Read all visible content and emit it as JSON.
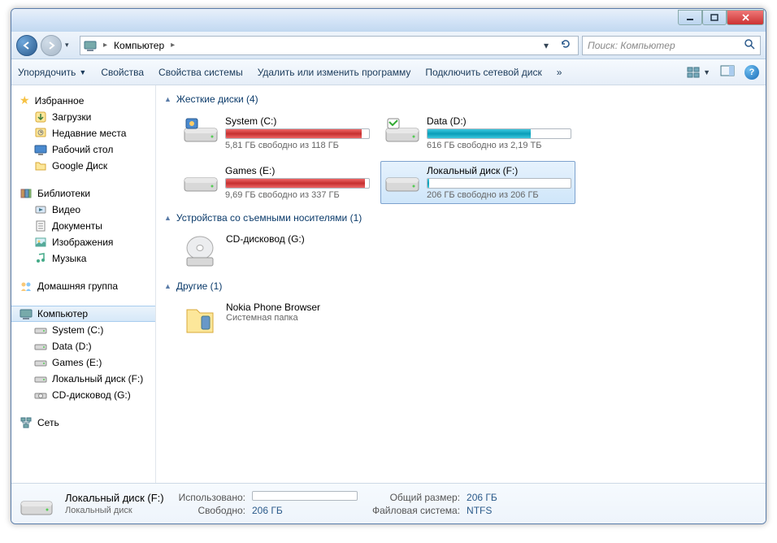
{
  "titlebar": {},
  "nav": {
    "breadcrumb_root": "Компьютер",
    "search_placeholder": "Поиск: Компьютер"
  },
  "toolbar": {
    "organize": "Упорядочить",
    "properties": "Свойства",
    "system_properties": "Свойства системы",
    "uninstall": "Удалить или изменить программу",
    "network_drive": "Подключить сетевой диск",
    "more": "»"
  },
  "sidebar": {
    "favorites": {
      "label": "Избранное",
      "items": [
        {
          "label": "Загрузки"
        },
        {
          "label": "Недавние места"
        },
        {
          "label": "Рабочий стол"
        },
        {
          "label": "Google Диск"
        }
      ]
    },
    "libraries": {
      "label": "Библиотеки",
      "items": [
        {
          "label": "Видео"
        },
        {
          "label": "Документы"
        },
        {
          "label": "Изображения"
        },
        {
          "label": "Музыка"
        }
      ]
    },
    "homegroup": {
      "label": "Домашняя группа"
    },
    "computer": {
      "label": "Компьютер",
      "items": [
        {
          "label": "System (C:)"
        },
        {
          "label": "Data (D:)"
        },
        {
          "label": "Games (E:)"
        },
        {
          "label": "Локальный диск (F:)"
        },
        {
          "label": "CD-дисковод (G:)"
        }
      ]
    },
    "network": {
      "label": "Сеть"
    }
  },
  "sections": {
    "hdd": {
      "title": "Жесткие диски (4)"
    },
    "removable": {
      "title": "Устройства со съемными носителями (1)"
    },
    "other": {
      "title": "Другие (1)"
    }
  },
  "drives": [
    {
      "name": "System (C:)",
      "free_text": "5,81 ГБ свободно из 118 ГБ",
      "fill_pct": 95,
      "color": "#c53030",
      "layer_color": "#e66"
    },
    {
      "name": "Data (D:)",
      "free_text": "616 ГБ свободно из 2,19 ТБ",
      "fill_pct": 72,
      "color": "#0a9db8",
      "layer_color": "#3cc8de"
    },
    {
      "name": "Games (E:)",
      "free_text": "9,69 ГБ свободно из 337 ГБ",
      "fill_pct": 97,
      "color": "#c53030",
      "layer_color": "#e66"
    },
    {
      "name": "Локальный диск (F:)",
      "free_text": "206 ГБ свободно из 206 ГБ",
      "fill_pct": 1,
      "color": "#0a9db8",
      "layer_color": "#3cc8de",
      "selected": true
    }
  ],
  "removable_device": {
    "name": "CD-дисковод (G:)"
  },
  "other_item": {
    "name": "Nokia Phone Browser",
    "sub": "Системная папка"
  },
  "status": {
    "title": "Локальный диск (F:)",
    "sub": "Локальный диск",
    "used_label": "Использовано:",
    "free_label": "Свободно:",
    "free_val": "206 ГБ",
    "total_label": "Общий размер:",
    "total_val": "206 ГБ",
    "fs_label": "Файловая система:",
    "fs_val": "NTFS"
  }
}
